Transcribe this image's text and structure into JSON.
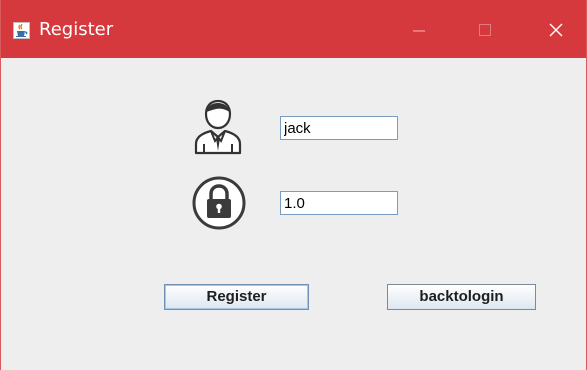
{
  "window": {
    "title": "Register",
    "titlebar_color": "#d6393d",
    "background_color": "#eeeeee",
    "controls": {
      "minimize_icon": "minimize-icon",
      "maximize_icon": "maximize-icon",
      "close_icon": "close-icon"
    },
    "app_icon": "java-cup-icon"
  },
  "form": {
    "username_icon": "user-icon",
    "password_icon": "lock-icon",
    "username_value": "jack",
    "password_value": "1.0"
  },
  "buttons": {
    "register_label": "Register",
    "back_label": "backtologin"
  }
}
